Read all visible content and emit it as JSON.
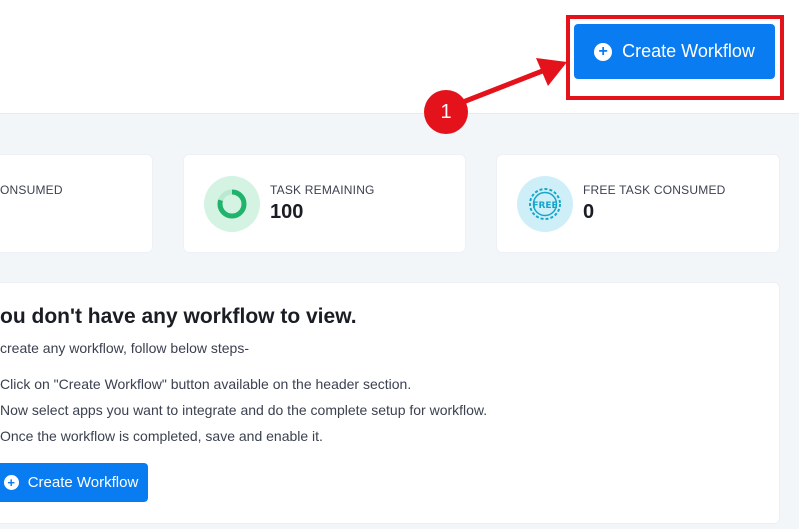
{
  "header": {
    "create_button_label": "Create Workflow"
  },
  "annotation": {
    "step_number": "1",
    "color": "#e3121b"
  },
  "stats": [
    {
      "label": "ONSUMED",
      "value": ""
    },
    {
      "label": "TASK REMAINING",
      "value": "100",
      "icon": "progress-ring-icon"
    },
    {
      "label": "FREE TASK CONSUMED",
      "value": "0",
      "icon": "free-badge-icon"
    }
  ],
  "empty_state": {
    "title": "ou don't have any workflow to view.",
    "intro": "create any workflow, follow below steps-",
    "steps": [
      "Click on \"Create Workflow\" button available on the header section.",
      "Now select apps you want to integrate and do the complete setup for workflow.",
      "Once the workflow is completed, save and enable it."
    ],
    "button_label": "Create Workflow"
  },
  "colors": {
    "primary": "#0a7cf2",
    "accent_red": "#e3121b",
    "background": "#f3f6f9",
    "green_icon": "#1fb36b",
    "cyan_icon": "#17a6c9"
  }
}
